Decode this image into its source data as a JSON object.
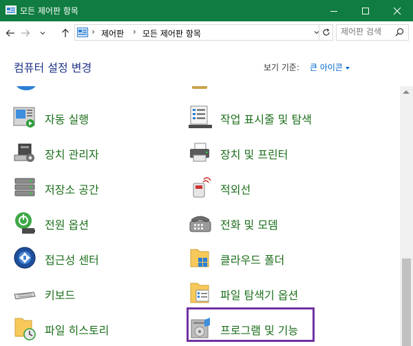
{
  "window": {
    "title": "모든 제어판 항목"
  },
  "address": {
    "crumbs": [
      "제어판",
      "모든 제어판 항목"
    ],
    "search_placeholder": "제어판 검색"
  },
  "header": {
    "heading": "컴퓨터 설정 변경",
    "view_by_label": "보기 기준:",
    "view_by_value": "큰 아이콘"
  },
  "items": [
    {
      "label": "자동 실행",
      "icon": "autoplay-icon"
    },
    {
      "label": "작업 표시줄 및 탐색",
      "icon": "taskbar-icon"
    },
    {
      "label": "장치 관리자",
      "icon": "device-manager-icon"
    },
    {
      "label": "장치 및 프린터",
      "icon": "printer-icon"
    },
    {
      "label": "저장소 공간",
      "icon": "storage-spaces-icon"
    },
    {
      "label": "적외선",
      "icon": "infrared-icon"
    },
    {
      "label": "전원 옵션",
      "icon": "power-options-icon"
    },
    {
      "label": "전화 및 모뎀",
      "icon": "phone-modem-icon"
    },
    {
      "label": "접근성 센터",
      "icon": "ease-of-access-icon"
    },
    {
      "label": "클라우드 폴더",
      "icon": "work-folders-icon"
    },
    {
      "label": "키보드",
      "icon": "keyboard-icon"
    },
    {
      "label": "파일 탐색기 옵션",
      "icon": "file-explorer-options-icon"
    },
    {
      "label": "파일 히스토리",
      "icon": "file-history-icon"
    },
    {
      "label": "프로그램 및 기능",
      "icon": "programs-features-icon"
    }
  ],
  "colors": {
    "titlebar": "#107c41",
    "link": "#1b6e1b",
    "heading": "#1e3287",
    "highlight": "#7030a0"
  }
}
